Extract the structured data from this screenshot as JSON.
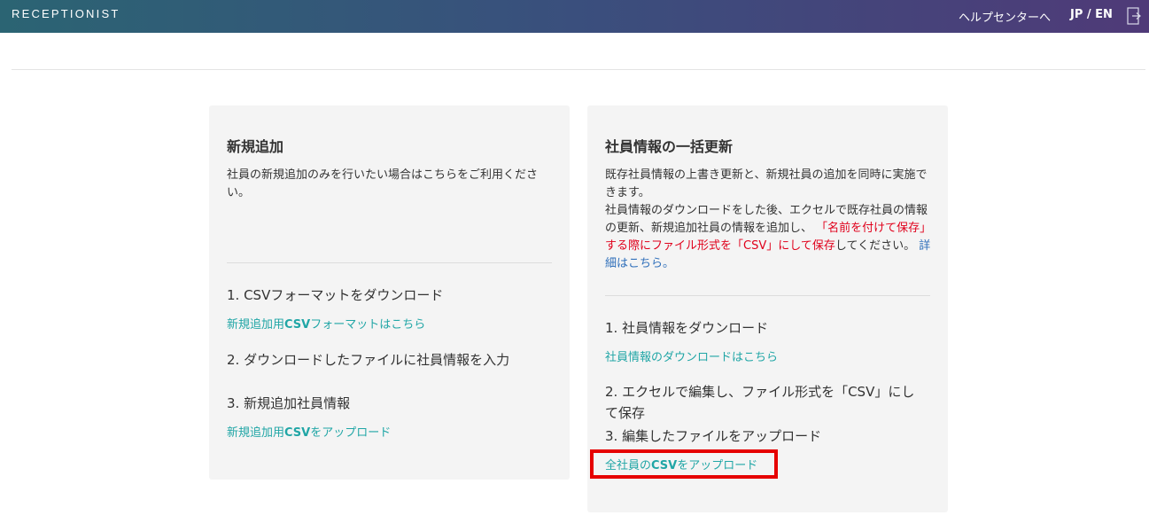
{
  "header": {
    "brand": "RECEPTIONIST",
    "help_link": "ヘルプセンターへ",
    "language": "JP / EN",
    "logout_icon": "logout-icon"
  },
  "new_add": {
    "title": "新規追加",
    "description": "社員の新規追加のみを行いたい場合はこちらをご利用ください。",
    "step1": "1. CSVフォーマットをダウンロード",
    "step1_link_prefix": "新規追加用",
    "step1_link_bold": "CSV",
    "step1_link_suffix": "フォーマットはこちら",
    "step2": "2. ダウンロードしたファイルに社員情報を入力",
    "step3": "3. 新規追加社員情報",
    "step3_link_prefix": "新規追加用",
    "step3_link_bold": "CSV",
    "step3_link_suffix": "をアップロード"
  },
  "bulk_update": {
    "title": "社員情報の一括更新",
    "desc_line1": "既存社員情報の上書き更新と、新規社員の追加を同時に実施できます。",
    "desc_line2": "社員情報のダウンロードをした後、エクセルで既存社員の情報の更新、新規追加社員の情報を追加し、",
    "desc_warning": "「名前を付けて保存」する際にファイル形式を「CSV」にして保存",
    "desc_line3": "してください。",
    "details_link": "詳細はこちら。",
    "step1": "1. 社員情報をダウンロード",
    "step1_link": "社員情報のダウンロードはこちら",
    "step2": "2. エクセルで編集し、ファイル形式を「CSV」にして保存",
    "step3": "3. 編集したファイルをアップロード",
    "step3_link_prefix": "全社員の",
    "step3_link_bold": "CSV",
    "step3_link_suffix": "をアップロード"
  },
  "colors": {
    "link": "#21a6a6",
    "warning": "#e0001b",
    "highlight": "#e60000"
  }
}
